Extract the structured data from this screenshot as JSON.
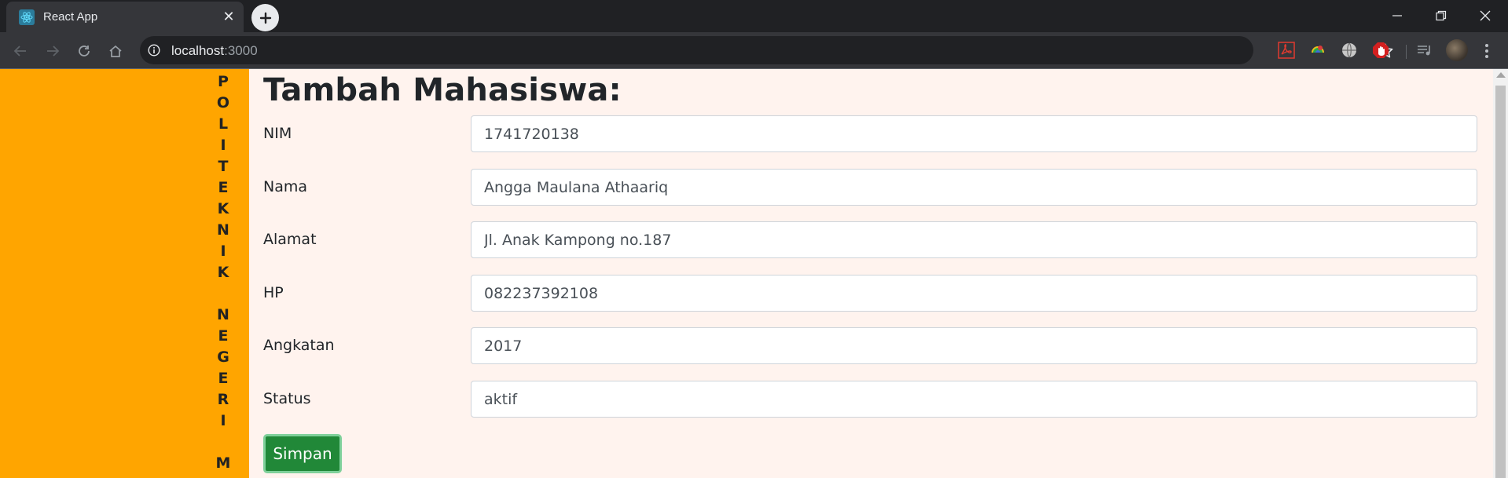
{
  "browser": {
    "tab_title": "React App",
    "url_host": "localhost",
    "url_port": ":3000"
  },
  "page": {
    "sidebar_text": [
      "P",
      "O",
      "L",
      "I",
      "T",
      "E",
      "K",
      "N",
      "I",
      "K",
      "",
      "N",
      "E",
      "G",
      "E",
      "R",
      "I",
      "",
      "M"
    ],
    "title": "Tambah Mahasiswa:",
    "fields": [
      {
        "label": "NIM",
        "value": "1741720138"
      },
      {
        "label": "Nama",
        "value": "Angga Maulana Athaariq"
      },
      {
        "label": "Alamat",
        "value": "Jl. Anak Kampong no.187"
      },
      {
        "label": "HP",
        "value": "082237392108"
      },
      {
        "label": "Angkatan",
        "value": "2017"
      },
      {
        "label": "Status",
        "value": "aktif"
      }
    ],
    "submit_label": "Simpan"
  },
  "colors": {
    "sidebar": "#ffa500",
    "page_background": "#fff3ee",
    "submit_button": "#218838"
  }
}
